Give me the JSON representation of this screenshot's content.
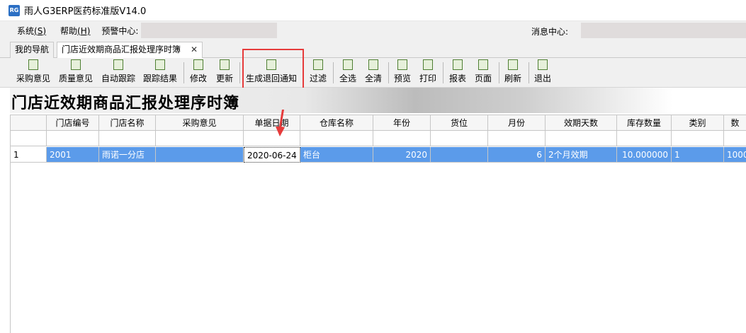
{
  "window": {
    "title": "雨人G3ERP医药标准版V14.0"
  },
  "menu": {
    "items": [
      {
        "text": "系统",
        "key": "(S)"
      },
      {
        "text": "帮助",
        "key": "(H)"
      }
    ],
    "alert_label": "预警中心:",
    "message_label": "消息中心:"
  },
  "tabs": {
    "nav": "我的导航",
    "active": "门店近效期商品汇报处理序时簿",
    "close": "✕"
  },
  "toolbar": {
    "buttons": [
      "采购意见",
      "质量意见",
      "自动跟踪",
      "跟踪结果",
      "修改",
      "更新",
      "生成退回通知",
      "过滤",
      "全选",
      "全清",
      "预览",
      "打印",
      "报表",
      "页面",
      "刷新",
      "退出"
    ]
  },
  "banner": {
    "title": "门店近效期商品汇报处理序时簿"
  },
  "grid": {
    "columns": [
      "门店编号",
      "门店名称",
      "采购意见",
      "单据日期",
      "仓库名称",
      "年份",
      "货位",
      "月份",
      "效期天数",
      "库存数量",
      "类别",
      "数"
    ],
    "rows": [
      {
        "index": "1",
        "cells": [
          "2001",
          "雨诺一分店",
          "",
          "2020-06-24",
          "柜台",
          "2020",
          "",
          "6",
          "2个月效期",
          "10.000000",
          "1",
          "1000"
        ]
      }
    ]
  },
  "colors": {
    "selected_row": "#5b9bea",
    "highlight_border": "#e63b3b"
  }
}
